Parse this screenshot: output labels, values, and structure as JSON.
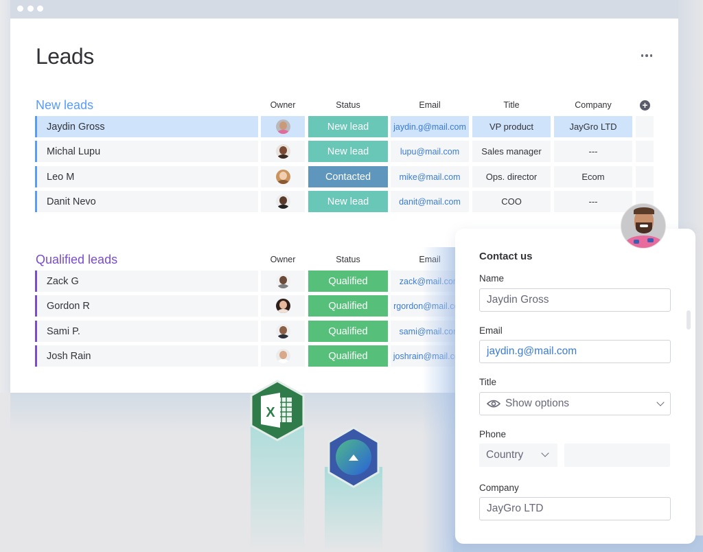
{
  "window": {
    "title": "Leads",
    "more_icon": "more-horizontal-icon"
  },
  "colors": {
    "new_group": "#579bfc",
    "qualified_group": "#784bd1",
    "status_new_lead": "#68c7b7",
    "status_contacted": "#5f96bd",
    "status_qualified": "#56c07a",
    "email_link": "#3a7bd5"
  },
  "groups": [
    {
      "title": "New leads",
      "columns": [
        "Owner",
        "Status",
        "Email",
        "Title",
        "Company"
      ],
      "rows": [
        {
          "name": "Jaydin Gross",
          "status": "New lead",
          "email": "jaydin.g@mail.com",
          "title": "VP product",
          "company": "JayGro LTD",
          "selected": true
        },
        {
          "name": "Michal Lupu",
          "status": "New lead",
          "email": "lupu@mail.com",
          "title": "Sales manager",
          "company": "---"
        },
        {
          "name": "Leo M",
          "status": "Contacted",
          "email": "mike@mail.com",
          "title": "Ops. director",
          "company": "Ecom"
        },
        {
          "name": "Danit Nevo",
          "status": "New lead",
          "email": "danit@mail.com",
          "title": "COO",
          "company": "---"
        }
      ]
    },
    {
      "title": "Qualified leads",
      "columns": [
        "Owner",
        "Status",
        "Email"
      ],
      "rows": [
        {
          "name": "Zack G",
          "status": "Qualified",
          "email": "zack@mail.com"
        },
        {
          "name": "Gordon R",
          "status": "Qualified",
          "email": "rgordon@mail.com"
        },
        {
          "name": "Sami P.",
          "status": "Qualified",
          "email": "sami@mail.com"
        },
        {
          "name": "Josh Rain",
          "status": "Qualified",
          "email": "joshrain@mail.com"
        }
      ]
    }
  ],
  "add_column_icon": "plus-circle-icon",
  "integrations": [
    {
      "name": "excel-icon",
      "letter": "X"
    },
    {
      "name": "app-integration-icon"
    }
  ],
  "form": {
    "title": "Contact us",
    "fields": {
      "name": {
        "label": "Name",
        "value": "Jaydin Gross"
      },
      "email": {
        "label": "Email",
        "value": "jaydin.g@mail.com"
      },
      "title": {
        "label": "Title",
        "placeholder": "Show options"
      },
      "phone": {
        "label": "Phone",
        "country_placeholder": "Country",
        "value": ""
      },
      "company": {
        "label": "Company",
        "value": "JayGro LTD"
      }
    }
  }
}
